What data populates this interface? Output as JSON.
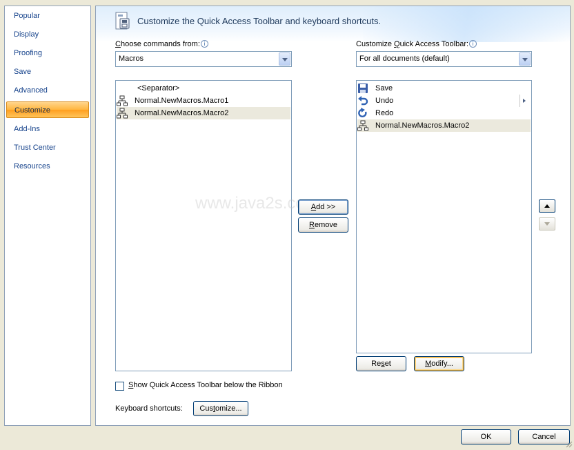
{
  "sidebar": {
    "items": [
      {
        "label": "Popular"
      },
      {
        "label": "Display"
      },
      {
        "label": "Proofing"
      },
      {
        "label": "Save"
      },
      {
        "label": "Advanced"
      },
      {
        "label": "Customize",
        "selected": true
      },
      {
        "label": "Add-Ins"
      },
      {
        "label": "Trust Center"
      },
      {
        "label": "Resources"
      }
    ]
  },
  "header": {
    "title": "Customize the Quick Access Toolbar and keyboard shortcuts.",
    "icon": "toolbar-customize-icon"
  },
  "left": {
    "label_pre": "C",
    "label_post": "hoose commands from:",
    "dropdown_value": "Macros",
    "commands": [
      {
        "label": "<Separator>",
        "icon": "none"
      },
      {
        "label": "Normal.NewMacros.Macro1",
        "icon": "macro-icon"
      },
      {
        "label": "Normal.NewMacros.Macro2",
        "icon": "macro-icon",
        "highlighted": true
      }
    ]
  },
  "middle": {
    "add_u": "A",
    "add_rest": "dd >>",
    "remove_u": "R",
    "remove_rest": "emove",
    "watermark": "www.java2s.com"
  },
  "right": {
    "label_pre": "Customize ",
    "label_u": "Q",
    "label_post": "uick Access Toolbar:",
    "dropdown_value": "For all documents (default)",
    "items": [
      {
        "label": "Save",
        "icon": "save-icon"
      },
      {
        "label": "Undo",
        "icon": "undo-icon"
      },
      {
        "label": "Redo",
        "icon": "redo-icon"
      },
      {
        "label": "Normal.NewMacros.Macro2",
        "icon": "macro-icon",
        "highlighted": true
      }
    ],
    "reset_pre": "Re",
    "reset_u": "s",
    "reset_post": "et",
    "modify_u": "M",
    "modify_rest": "odify..."
  },
  "options": {
    "checkbox_u": "S",
    "checkbox_rest": "how Quick Access Toolbar below the Ribbon",
    "checkbox_checked": false,
    "shortcuts_label": "Keyboard shortcuts:",
    "customize_pre": "Cus",
    "customize_u": "t",
    "customize_post": "omize..."
  },
  "footer": {
    "ok_label": "OK",
    "cancel_label": "Cancel"
  },
  "colors": {
    "sidebar_text": "#15428b",
    "selected_orange": "#ffb640",
    "highlight_row": "#ebe9dd"
  }
}
